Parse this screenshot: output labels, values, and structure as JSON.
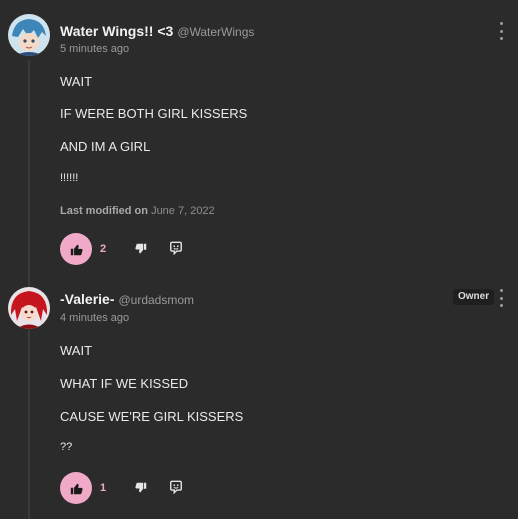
{
  "comments": [
    {
      "name": "Water Wings!! <3",
      "handle": "@WaterWings",
      "time": "5 minutes ago",
      "lines": [
        "WAIT",
        "IF WERE BOTH GIRL KISSERS",
        "AND IM A GIRL",
        "!!!!!!"
      ],
      "modified_label": "Last modified on",
      "modified_date": "June 7, 2022",
      "likes": "2",
      "avatar_icon": "blue-hair-anime-avatar"
    },
    {
      "name": "-Valerie-",
      "handle": "@urdadsmom",
      "time": "4 minutes ago",
      "badge": "Owner",
      "lines": [
        "WAIT",
        "WHAT IF WE KISSED",
        "CAUSE WE'RE GIRL KISSERS",
        "??"
      ],
      "likes": "1",
      "avatar_icon": "red-hair-anime-avatar"
    }
  ],
  "colors": {
    "background": "#2b2b2b",
    "like_accent": "#f1a9c8",
    "muted_text": "#9a9a9a"
  },
  "icons": [
    "thumbs-up-icon",
    "thumbs-down-icon",
    "reply-icon",
    "more-options-icon"
  ]
}
